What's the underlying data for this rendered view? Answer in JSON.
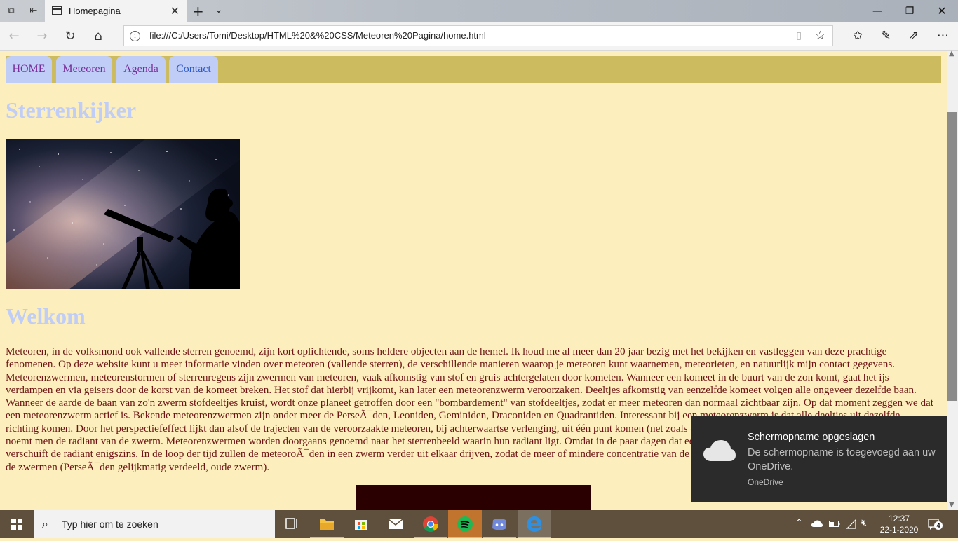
{
  "browser": {
    "tab_title": "Homepagina",
    "url": "file:///C:/Users/Tomi/Desktop/HTML%20&%20CSS/Meteoren%20Pagina/home.html"
  },
  "page": {
    "menu": [
      "HOME",
      "Meteoren",
      "Agenda",
      "Contact"
    ],
    "site_title": "Sterrenkijker",
    "welcome_heading": "Welkom",
    "intro_text": "Meteoren, in de volksmond ook vallende sterren genoemd, zijn kort oplichtende, soms heldere objecten aan de hemel. Ik houd me al meer dan 20 jaar bezig met het bekijken en vastleggen van deze prachtige fenomenen. Op deze website kunt u meer informatie vinden over meteoren (vallende sterren), de verschillende manieren waarop je meteoren kunt waarnemen, meteorieten, en natuurlijk mijn contact gegevens. Meteorenzwermen, meteorenstormen of sterrenregens zijn zwermen van meteoren, vaak afkomstig van stof en gruis achtergelaten door kometen. Wanneer een komeet in de buurt van de zon komt, gaat het ijs verdampen en via geisers door de korst van de komeet breken. Het stof dat hierbij vrijkomt, kan later een meteorenzwerm veroorzaken. Deeltjes afkomstig van eenzelfde komeet volgen alle ongeveer dezelfde baan. Wanneer de aarde de baan van zo'n zwerm stofdeeltjes kruist, wordt onze planeet getroffen door een \"bombardement\" van stofdeeltjes, zodat er meer meteoren dan normaal zichtbaar zijn. Op dat moment zeggen we dat een meteorenzwerm actief is. Bekende meteorenzwermen zijn onder meer de PerseÃ¯den, Leoniden, Geminiden, Draconiden en Quadrantiden. Interessant bij een meteorenzwerm is dat alle deeltjes uit dezelfde richting komen. Door het perspectiefeffect lijkt dan alsof de trajecten van de veroorzaakte meteoren, bij achterwaartse verlenging, uit één punt komen (net zoals de sporen van een lange, rechte spoorweg). Dit punt noemt men de radiant van de zwerm. Meteorenzwermen worden doorgaans genoemd naar het sterrenbeeld waarin hun radiant ligt. Omdat in de paar dagen dat een zwerm te zien is de aarde verder trekt in zijn baan verschuift de radiant enigszins. In de loop der tijd zullen de meteoroÃ¯den in een zwerm verder uit elkaar drijven, zodat de meer of mindere concentratie van de deeltjes een aanwijzing geeft omtrent de ouderdom van de zwermen (PerseÃ¯den gelijkmatig verdeeld, oude zwerm)."
  },
  "notification": {
    "title": "Schermopname opgeslagen",
    "body": "De schermopname is toegevoegd aan uw OneDrive.",
    "app": "OneDrive"
  },
  "taskbar": {
    "search_placeholder": "Typ hier om te zoeken",
    "time": "12:37",
    "date": "22-1-2020",
    "notification_count": "4"
  },
  "colors": {
    "page_background": "#fdefbd",
    "menu_bar": "#cdbb60",
    "menu_button": "#bfcdf7",
    "heading": "#bfcdf7",
    "body_text": "#6d1414"
  }
}
